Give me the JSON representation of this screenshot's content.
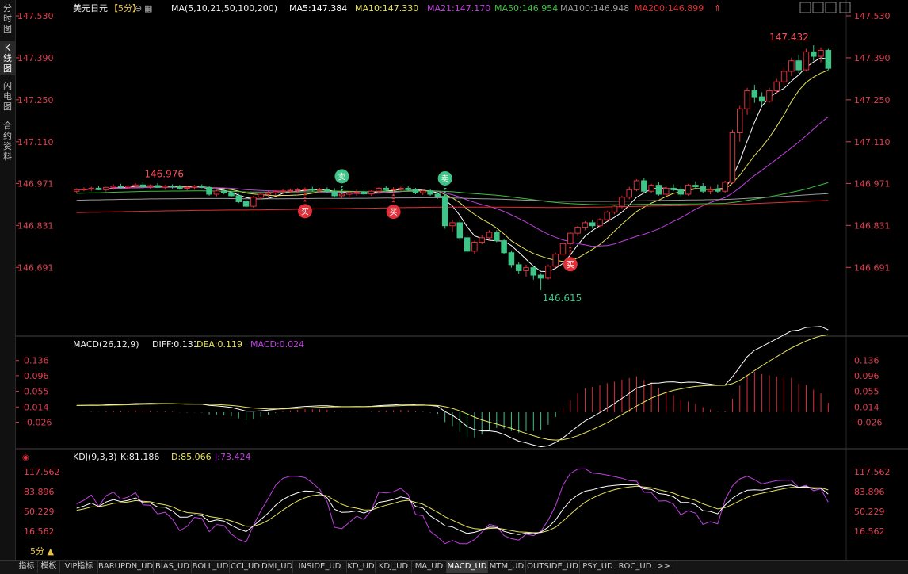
{
  "sidebar": {
    "items": [
      {
        "label": "分时图",
        "active": false
      },
      {
        "label": "K线图",
        "active": true
      },
      {
        "label": "闪电图",
        "active": false
      },
      {
        "label": "合约资料",
        "active": false
      }
    ]
  },
  "main_header": {
    "symbol": "美元日元",
    "period": "【5分】",
    "ma_params": "MA(5,10,21,50,100,200)",
    "ma5": "MA5:147.384",
    "ma10": "MA10:147.330",
    "ma21": "MA21:147.170",
    "ma50": "MA50:146.954",
    "ma100": "MA100:146.948",
    "ma200": "MA200:146.899"
  },
  "macd_header": {
    "title": "MACD(26,12,9)",
    "diff": "DIFF:0.131",
    "dea": "DEA:0.119",
    "macd": "MACD:0.024"
  },
  "kdj_header": {
    "title": "KDJ(9,3,3)",
    "k": "K:81.186",
    "d": "D:85.066",
    "j": "J:73.424"
  },
  "period_button": "5分 ▲",
  "bottom_tabs": [
    "指标",
    "模板",
    "VIP指标",
    "BARUPDN_UD",
    "BIAS_UD",
    "BOLL_UD",
    "CCI_UD",
    "DMI_UD",
    "INSIDE_UD",
    "KD_UD",
    "KDJ_UD",
    "MA_UD",
    "MACD_UD",
    "MTM_UD",
    "OUTSIDE_UD",
    "PSY_UD",
    "ROC_UD",
    ">>"
  ],
  "active_tab": "MACD_UD",
  "colors": {
    "up": "#e0303a",
    "down": "#3ec486",
    "ma5": "#ffffff",
    "ma10": "#e8e35a",
    "ma21": "#c040e0",
    "ma50": "#40c040",
    "ma100": "#9a9a9a",
    "ma200": "#e03030",
    "axis_text": "#e04050",
    "grid": "#333333"
  },
  "chart_data": [
    {
      "type": "candlestick",
      "title": "美元日元【5分】",
      "ylim": [
        146.615,
        147.53
      ],
      "y_ticks": [
        "147.530",
        "147.390",
        "147.250",
        "147.110",
        "146.971",
        "146.831",
        "146.691"
      ],
      "annotations": {
        "high_label": "147.432",
        "high2_label": "146.976",
        "low_label": "146.615",
        "signals": [
          {
            "label": "卖",
            "kind": "sell",
            "bar": 36
          },
          {
            "label": "卖",
            "kind": "sell",
            "bar": 50
          },
          {
            "label": "买",
            "kind": "buy",
            "bar": 31
          },
          {
            "label": "买",
            "kind": "buy",
            "bar": 43
          },
          {
            "label": "买",
            "kind": "buy",
            "bar": 67
          }
        ]
      },
      "candles": [
        [
          146.945,
          146.955,
          146.94,
          146.95
        ],
        [
          146.95,
          146.958,
          146.945,
          146.952
        ],
        [
          146.952,
          146.96,
          146.946,
          146.955
        ],
        [
          146.955,
          146.962,
          146.948,
          146.95
        ],
        [
          146.95,
          146.96,
          146.944,
          146.958
        ],
        [
          146.958,
          146.968,
          146.95,
          146.962
        ],
        [
          146.962,
          146.97,
          146.955,
          146.958
        ],
        [
          146.958,
          146.966,
          146.95,
          146.962
        ],
        [
          146.962,
          146.972,
          146.956,
          146.966
        ],
        [
          146.966,
          146.976,
          146.958,
          146.96
        ],
        [
          146.96,
          146.968,
          146.952,
          146.964
        ],
        [
          146.964,
          146.972,
          146.956,
          146.958
        ],
        [
          146.958,
          146.966,
          146.95,
          146.962
        ],
        [
          146.962,
          146.968,
          146.954,
          146.96
        ],
        [
          146.96,
          146.966,
          146.95,
          146.955
        ],
        [
          146.955,
          146.962,
          146.946,
          146.958
        ],
        [
          146.958,
          146.966,
          146.95,
          146.962
        ],
        [
          146.962,
          146.968,
          146.955,
          146.958
        ],
        [
          146.958,
          146.962,
          146.93,
          146.935
        ],
        [
          146.935,
          146.95,
          146.928,
          146.946
        ],
        [
          146.946,
          146.952,
          146.935,
          146.94
        ],
        [
          146.94,
          146.946,
          146.925,
          146.93
        ],
        [
          146.93,
          146.936,
          146.905,
          146.91
        ],
        [
          146.91,
          146.918,
          146.89,
          146.895
        ],
        [
          146.895,
          146.93,
          146.89,
          146.925
        ],
        [
          146.925,
          146.94,
          146.918,
          146.935
        ],
        [
          146.935,
          146.945,
          146.925,
          146.94
        ],
        [
          146.94,
          146.948,
          146.93,
          146.944
        ],
        [
          146.944,
          146.952,
          146.936,
          146.946
        ],
        [
          146.946,
          146.954,
          146.938,
          146.948
        ],
        [
          146.948,
          146.956,
          146.94,
          146.95
        ],
        [
          146.95,
          146.958,
          146.942,
          146.952
        ],
        [
          146.952,
          146.96,
          146.944,
          146.948
        ],
        [
          146.948,
          146.956,
          146.94,
          146.95
        ],
        [
          146.95,
          146.958,
          146.94,
          146.945
        ],
        [
          146.945,
          146.955,
          146.925,
          146.93
        ],
        [
          146.93,
          146.942,
          146.92,
          146.935
        ],
        [
          146.935,
          146.945,
          146.925,
          146.94
        ],
        [
          146.94,
          146.95,
          146.93,
          146.942
        ],
        [
          146.942,
          146.95,
          146.932,
          146.936
        ],
        [
          146.936,
          146.948,
          146.93,
          146.945
        ],
        [
          146.945,
          146.958,
          146.94,
          146.955
        ],
        [
          146.955,
          146.962,
          146.945,
          146.95
        ],
        [
          146.95,
          146.958,
          146.94,
          146.952
        ],
        [
          146.952,
          146.96,
          146.944,
          146.955
        ],
        [
          146.955,
          146.962,
          146.946,
          146.95
        ],
        [
          146.95,
          146.956,
          146.935,
          146.94
        ],
        [
          146.94,
          146.95,
          146.932,
          146.946
        ],
        [
          146.946,
          146.952,
          146.93,
          146.935
        ],
        [
          146.935,
          146.942,
          146.92,
          146.928
        ],
        [
          146.928,
          146.935,
          146.82,
          146.83
        ],
        [
          146.83,
          146.85,
          146.81,
          146.84
        ],
        [
          146.84,
          146.848,
          146.78,
          146.79
        ],
        [
          146.79,
          146.798,
          146.74,
          146.745
        ],
        [
          146.745,
          146.78,
          146.735,
          146.775
        ],
        [
          146.775,
          146.8,
          146.768,
          146.79
        ],
        [
          146.79,
          146.815,
          146.782,
          146.808
        ],
        [
          146.808,
          146.815,
          146.775,
          146.78
        ],
        [
          146.78,
          146.786,
          146.735,
          146.74
        ],
        [
          146.74,
          146.748,
          146.69,
          146.7
        ],
        [
          146.7,
          146.708,
          146.67,
          146.68
        ],
        [
          146.68,
          146.7,
          146.66,
          146.69
        ],
        [
          146.69,
          146.696,
          146.65,
          146.665
        ],
        [
          146.665,
          146.672,
          146.615,
          146.655
        ],
        [
          146.655,
          146.7,
          146.65,
          146.695
        ],
        [
          146.695,
          146.74,
          146.69,
          146.735
        ],
        [
          146.735,
          146.775,
          146.728,
          146.77
        ],
        [
          146.77,
          146.81,
          146.765,
          146.805
        ],
        [
          146.805,
          146.83,
          146.795,
          146.825
        ],
        [
          146.825,
          146.845,
          146.815,
          146.84
        ],
        [
          146.84,
          146.85,
          146.82,
          146.83
        ],
        [
          146.83,
          146.855,
          146.825,
          146.85
        ],
        [
          146.85,
          146.88,
          146.845,
          146.875
        ],
        [
          146.875,
          146.9,
          146.868,
          146.895
        ],
        [
          146.895,
          146.93,
          146.888,
          146.925
        ],
        [
          146.925,
          146.96,
          146.918,
          146.95
        ],
        [
          146.95,
          146.985,
          146.945,
          146.98
        ],
        [
          146.98,
          146.99,
          146.94,
          146.945
        ],
        [
          146.945,
          146.97,
          146.94,
          146.965
        ],
        [
          146.965,
          146.975,
          146.93,
          146.935
        ],
        [
          146.935,
          146.96,
          146.928,
          146.955
        ],
        [
          146.955,
          146.968,
          146.945,
          146.95
        ],
        [
          146.95,
          146.96,
          146.925,
          146.935
        ],
        [
          146.935,
          146.97,
          146.93,
          146.965
        ],
        [
          146.965,
          146.978,
          146.955,
          146.96
        ],
        [
          146.96,
          146.972,
          146.94,
          146.945
        ],
        [
          146.945,
          146.96,
          146.935,
          146.95
        ],
        [
          146.95,
          146.968,
          146.94,
          146.945
        ],
        [
          146.945,
          146.98,
          146.94,
          146.975
        ],
        [
          146.975,
          147.15,
          146.97,
          147.14
        ],
        [
          147.14,
          147.23,
          147.11,
          147.22
        ],
        [
          147.22,
          147.29,
          147.2,
          147.28
        ],
        [
          147.28,
          147.3,
          147.24,
          147.26
        ],
        [
          147.26,
          147.275,
          147.23,
          147.245
        ],
        [
          147.245,
          147.29,
          147.24,
          147.28
        ],
        [
          147.28,
          147.32,
          147.27,
          147.31
        ],
        [
          147.31,
          147.355,
          147.3,
          147.345
        ],
        [
          147.345,
          147.39,
          147.33,
          147.38
        ],
        [
          147.38,
          147.4,
          147.34,
          147.35
        ],
        [
          147.35,
          147.42,
          147.345,
          147.41
        ],
        [
          147.41,
          147.432,
          147.38,
          147.395
        ],
        [
          147.395,
          147.425,
          147.375,
          147.415
        ],
        [
          147.415,
          147.42,
          147.35,
          147.355
        ]
      ]
    },
    {
      "type": "macd",
      "title": "MACD(26,12,9)",
      "ylim": [
        -0.05,
        0.15
      ],
      "y_ticks": [
        "0.136",
        "0.096",
        "0.055",
        "0.014",
        "-0.026"
      ]
    },
    {
      "type": "kdj",
      "title": "KDJ(9,3,3)",
      "ylim": [
        0,
        130
      ],
      "y_ticks": [
        "117.562",
        "83.896",
        "50.229",
        "16.562"
      ]
    }
  ]
}
